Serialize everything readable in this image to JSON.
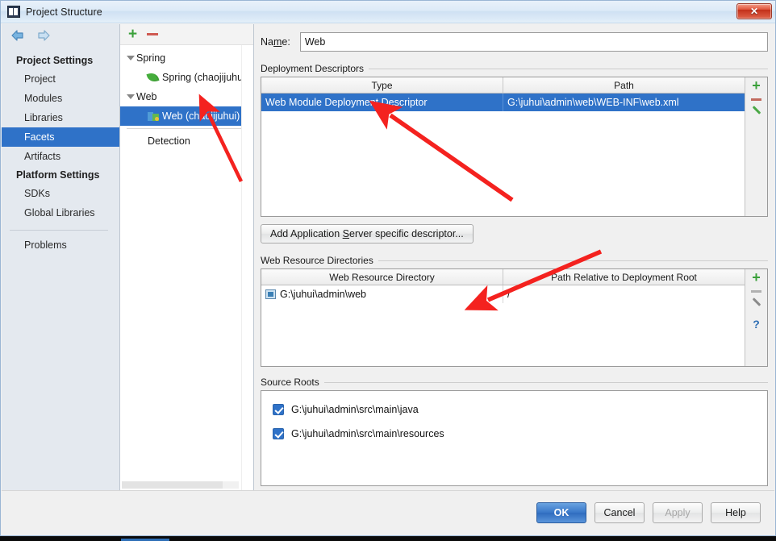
{
  "window": {
    "title": "Project Structure",
    "icon": "project-structure-icon",
    "close_label": "✕"
  },
  "nav": {
    "back_icon": "arrow-left-icon",
    "forward_icon": "arrow-right-icon",
    "groups": [
      {
        "label": "Project Settings",
        "items": [
          {
            "label": "Project",
            "selected": false
          },
          {
            "label": "Modules",
            "selected": false
          },
          {
            "label": "Libraries",
            "selected": false
          },
          {
            "label": "Facets",
            "selected": true
          },
          {
            "label": "Artifacts",
            "selected": false
          }
        ]
      },
      {
        "label": "Platform Settings",
        "items": [
          {
            "label": "SDKs",
            "selected": false
          },
          {
            "label": "Global Libraries",
            "selected": false
          }
        ]
      }
    ],
    "extra_items": [
      {
        "label": "Problems",
        "selected": false
      }
    ]
  },
  "tree": {
    "toolbar": {
      "add": "+",
      "remove": "−"
    },
    "rows": [
      {
        "label": "Spring",
        "level": 0,
        "twisty": true,
        "icon": null,
        "selected": false
      },
      {
        "label": "Spring (chaojijuhu",
        "level": 1,
        "twisty": false,
        "icon": "spring-leaf-icon",
        "selected": false
      },
      {
        "label": "Web",
        "level": 0,
        "twisty": true,
        "icon": null,
        "selected": false
      },
      {
        "label": "Web (chaojijuhui)",
        "level": 1,
        "twisty": false,
        "icon": "web-facet-icon",
        "selected": true
      }
    ],
    "after_separator": [
      {
        "label": "Detection",
        "level": 0,
        "twisty": false,
        "icon": null,
        "selected": false
      }
    ]
  },
  "main": {
    "name_label": "Name:",
    "name_value": "Web",
    "name_placeholder": "",
    "deployment": {
      "section_label": "Deployment Descriptors",
      "columns": [
        "Type",
        "Path"
      ],
      "rows": [
        {
          "type": "Web Module Deployment Descriptor",
          "path": "G:\\juhui\\admin\\web\\WEB-INF\\web.xml",
          "selected": true
        }
      ],
      "tools": [
        "add-icon",
        "remove-icon",
        "edit-icon"
      ]
    },
    "add_descriptor_button": "Add Application Server specific descriptor...",
    "web_resources": {
      "section_label": "Web Resource Directories",
      "columns": [
        "Web Resource Directory",
        "Path Relative to Deployment Root"
      ],
      "rows": [
        {
          "directory": "G:\\juhui\\admin\\web",
          "relative_path": "/",
          "icon": "directory-icon",
          "selected": false
        }
      ],
      "tools": [
        "add-icon",
        "remove-icon",
        "edit-icon",
        "help-icon"
      ]
    },
    "source_roots": {
      "section_label": "Source Roots",
      "items": [
        {
          "label": "G:\\juhui\\admin\\src\\main\\java",
          "checked": true
        },
        {
          "label": "G:\\juhui\\admin\\src\\main\\resources",
          "checked": true
        }
      ]
    }
  },
  "footer": {
    "buttons": [
      {
        "label": "OK",
        "style": "primary"
      },
      {
        "label": "Cancel",
        "style": "normal"
      },
      {
        "label": "Apply",
        "style": "disabled"
      },
      {
        "label": "Help",
        "style": "normal"
      }
    ]
  },
  "colors": {
    "selection": "#2f72c8",
    "annotation_arrow": "#f4221f",
    "add_icon": "#3aa03a",
    "remove_icon": "#c16a5e"
  }
}
